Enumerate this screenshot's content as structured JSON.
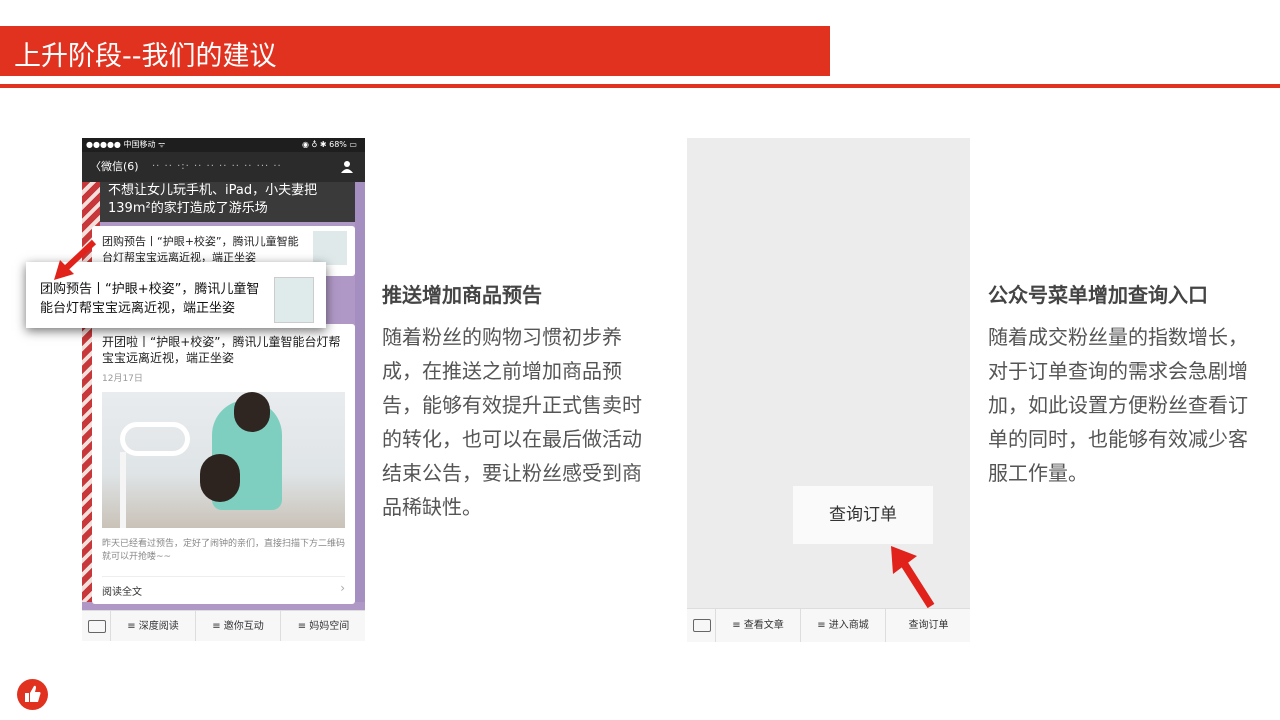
{
  "header": {
    "title": "上升阶段--我们的建议"
  },
  "left_phone": {
    "status_left": "●●●●● 中国移动 ᯤ",
    "status_right": "◉ ♁ ✱ 68% ▭",
    "back_label": "〈微信(6)",
    "nav_title": "·· ·· ·:· ·· ·· ·· ·· ·· ··· ··",
    "top_card_text": "不想让女儿玩手机、iPad，小夫妻把139m²的家打造成了游乐场",
    "card2_text": "团购预告丨“护眼+校姿”，腾讯儿童智能台灯帮宝宝远离近视，端正坐姿",
    "card3_title": "开团啦丨“护眼+校姿”，腾讯儿童智能台灯帮宝宝远离近视，端正坐姿",
    "card3_date": "12月17日",
    "card3_summary": "昨天已经看过预告，定好了闹钟的亲们，直接扫描下方二维码就可以开抢喽~~",
    "read_all": "阅读全文",
    "read_chevron": "›",
    "menu": [
      "≡ 深度阅读",
      "≡ 邀你互动",
      "≡ 妈妈空间"
    ]
  },
  "callout": {
    "text": "团购预告丨“护眼+校姿”，腾讯儿童智能台灯帮宝宝远离近视，端正坐姿"
  },
  "section1": {
    "heading": "推送增加商品预告",
    "body": "随着粉丝的购物习惯初步养成，在推送之前增加商品预告，能够有效提升正式售卖时的转化，也可以在最后做活动结束公告，要让粉丝感受到商品稀缺性。"
  },
  "right_phone": {
    "popup_label": "查询订单",
    "menu": [
      "≡ 查看文章",
      "≡ 进入商城",
      "查询订单"
    ]
  },
  "section2": {
    "heading": "公众号菜单增加查询入口",
    "body": "随着成交粉丝量的指数增长，对于订单查询的需求会急剧增加，如此设置方便粉丝查看订单的同时，也能够有效减少客服工作量。"
  },
  "colors": {
    "accent": "#e0321f"
  }
}
